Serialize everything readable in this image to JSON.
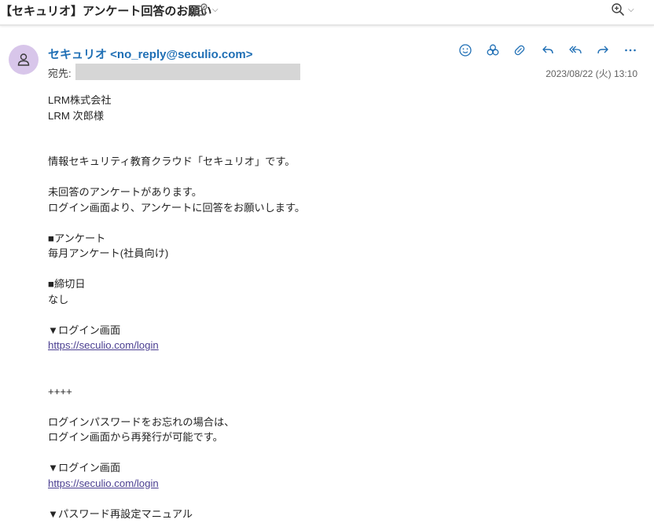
{
  "subject": "【セキュリオ】アンケート回答のお願い",
  "header": {
    "sender": "セキュリオ <no_reply@seculio.com>",
    "to_label": "宛先:",
    "date": "2023/08/22 (火) 13:10"
  },
  "body": {
    "company": "LRM株式会社",
    "recipient": "LRM 次郎様",
    "intro": "情報セキュリティ教育クラウド「セキュリオ」です。",
    "notice1": "未回答のアンケートがあります。",
    "notice2": "ログイン画面より、アンケートに回答をお願いします。",
    "survey_heading": "■アンケート",
    "survey_name": "毎月アンケート(社員向け)",
    "deadline_heading": "■締切日",
    "deadline_value": "なし",
    "login_heading": "▼ログイン画面",
    "login_link": "https://seculio.com/login",
    "separator": "++++",
    "pw_line1": "ログインパスワードをお忘れの場合は、",
    "pw_line2": "ログイン画面から再発行が可能です。",
    "login_heading2": "▼ログイン画面",
    "login_link2": "https://seculio.com/login",
    "manual_heading": "▼パスワード再設定マニュアル"
  },
  "icons": {
    "subject_action": "envelope-check-icon",
    "zoom": "zoom-in-icon",
    "avatar": "person-icon",
    "actions": [
      "smiley-icon",
      "apps-icon",
      "loop-icon",
      "reply-icon",
      "reply-all-icon",
      "forward-icon",
      "more-icon"
    ]
  },
  "colors": {
    "accent": "#1f6fb5",
    "link": "#4b3f91",
    "avatar_bg": "#d8c6ea"
  }
}
